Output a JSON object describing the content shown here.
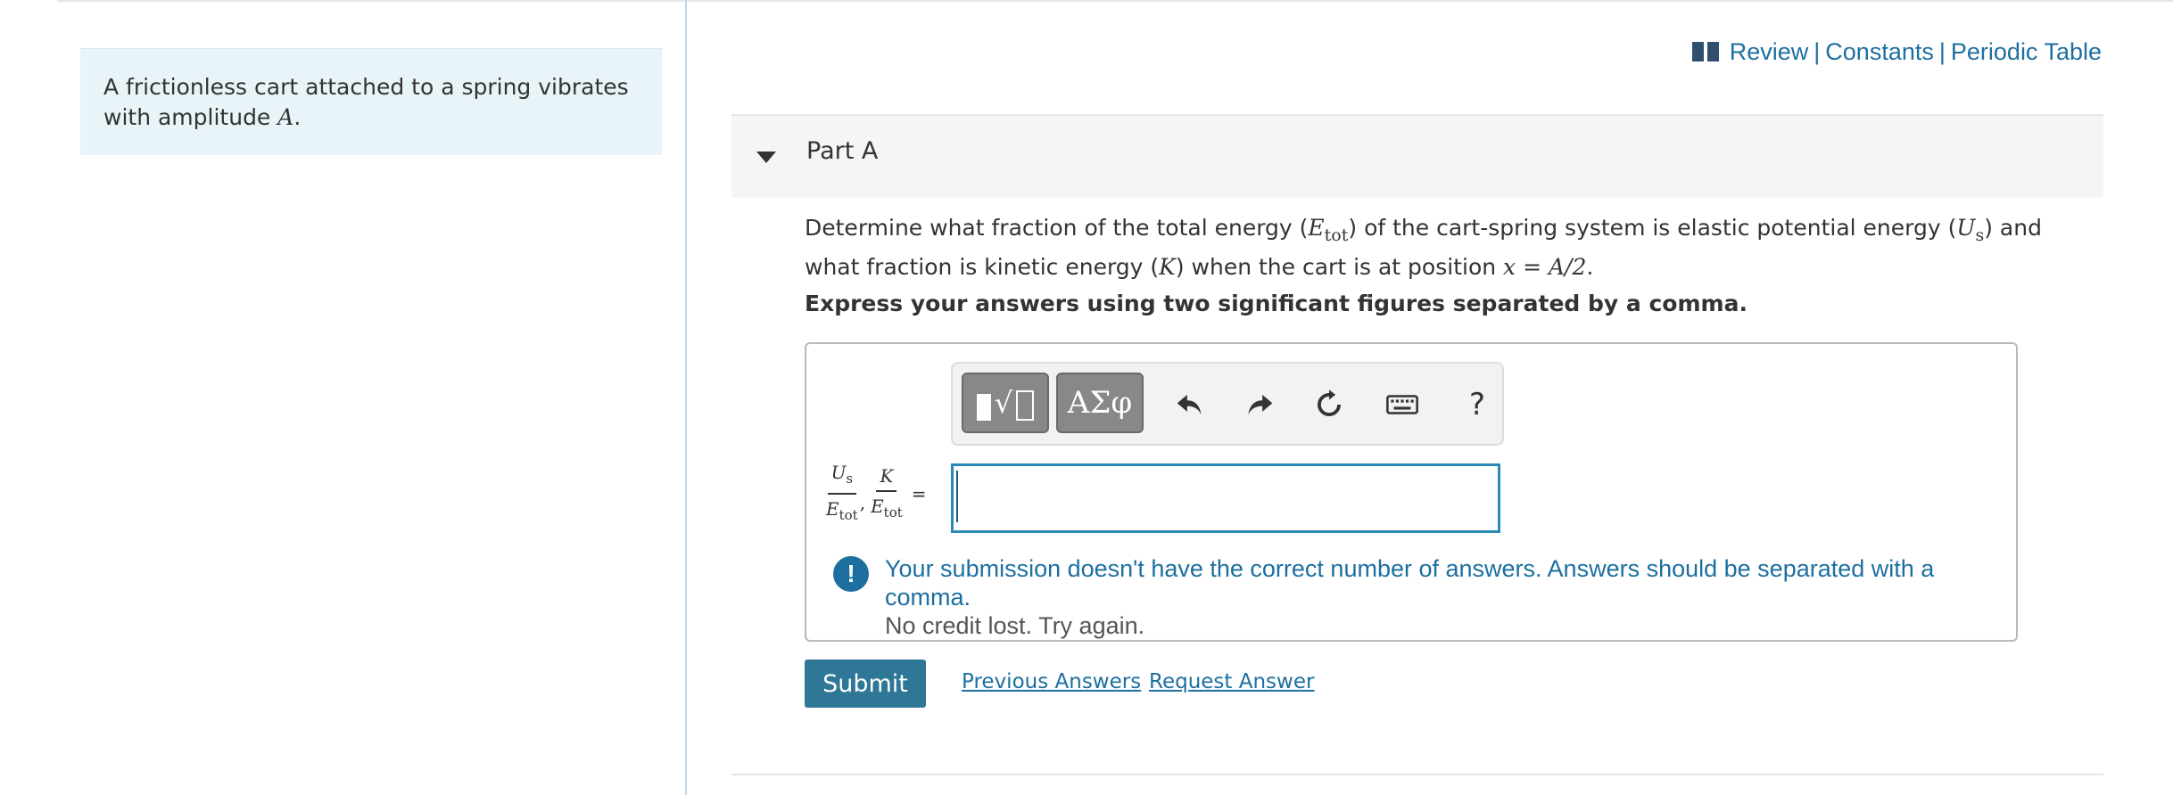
{
  "intro": {
    "text_before": "A frictionless cart attached to a spring vibrates with amplitude ",
    "var": "A",
    "text_after": "."
  },
  "links": {
    "review": "Review",
    "constants": "Constants",
    "periodic_table": "Periodic Table",
    "separator": "|",
    "icon": "book-icon"
  },
  "part": {
    "title": "Part A"
  },
  "question": {
    "p1": "Determine what fraction of the total energy (",
    "etot_e": "E",
    "etot_sub": "tot",
    "p2": ") of the cart-spring system is elastic potential energy (",
    "us_u": "U",
    "us_sub": "s",
    "p3": ") and what fraction is kinetic energy (",
    "k": "K",
    "p4": ") when the cart is at position ",
    "math_x": "x = A/2",
    "p5": "."
  },
  "instruction": "Express your answers using two significant figures separated by a comma.",
  "toolbar": {
    "templates_icon": "templates-icon",
    "greek": "ΑΣφ",
    "undo_icon": "undo-icon",
    "redo_icon": "redo-icon",
    "reset_icon": "reset-icon",
    "keyboard_icon": "keyboard-icon",
    "help": "?"
  },
  "answer_label": {
    "num1_var": "U",
    "num1_sub": "s",
    "den_var": "E",
    "den_sub": "tot",
    "num2_var": "K",
    "comma": ",",
    "equals": "="
  },
  "answer_input": {
    "value": ""
  },
  "feedback": {
    "icon": "!",
    "main": "Your submission doesn't have the correct number of answers. Answers should be separated with a comma.",
    "sub": "No credit lost. Try again."
  },
  "actions": {
    "submit": "Submit",
    "previous_answers": "Previous Answers",
    "request_answer": "Request Answer"
  },
  "colors": {
    "link": "#1d6fa0",
    "submit_bg": "#2e7796",
    "intro_bg": "#e8f4f8",
    "input_border": "#2a8ab5"
  }
}
